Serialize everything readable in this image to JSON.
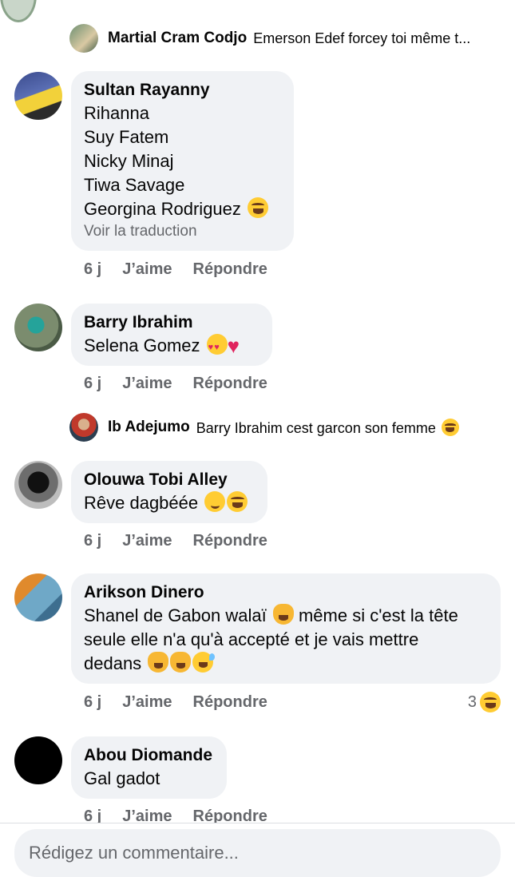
{
  "reply_1": {
    "author": "Martial Cram Codjo",
    "text": "Emerson Edef forcey toi même t..."
  },
  "comments": [
    {
      "author": "Sultan Rayanny",
      "lines": [
        "Rihanna",
        "Suy Fatem",
        "Nicky Minaj",
        "Tiwa Savage",
        "Georgina Rodriguez"
      ],
      "translate": "Voir la traduction",
      "time": "6 j",
      "like": "J’aime",
      "reply": "Répondre"
    },
    {
      "author": "Barry Ibrahim",
      "lines": [
        "Selena Gomez"
      ],
      "time": "6 j",
      "like": "J’aime",
      "reply": "Répondre"
    },
    {
      "author": "Olouwa Tobi Alley",
      "lines": [
        "Rêve dagbéée"
      ],
      "time": "6 j",
      "like": "J’aime",
      "reply": "Répondre"
    },
    {
      "author": "Arikson Dinero",
      "lines": [
        "Shanel de Gabon walaï",
        "même si c'est la tête",
        "seule elle n'a qu'à accepté et je vais mettre",
        "dedans"
      ],
      "time": "6 j",
      "like": "J’aime",
      "reply": "Répondre",
      "reaction_count": "3"
    },
    {
      "author": "Abou Diomande",
      "lines": [
        "Gal gadot"
      ],
      "time": "6 j",
      "like": "J’aime",
      "reply": "Répondre"
    }
  ],
  "reply_2": {
    "author": "Ib Adejumo",
    "text": "Barry Ibrahim cest garcon son femme"
  },
  "composer": {
    "placeholder": "Rédigez un commentaire..."
  },
  "icons": {
    "laugh": "face-with-tears-of-joy-icon",
    "love": "heart-eyes-icon",
    "heart": "red-heart-icon",
    "smile": "smiling-face-icon",
    "cat": "cat-tears-of-joy-icon",
    "sweat": "grinning-sweat-icon"
  },
  "colors": {
    "bubble": "#f0f2f5",
    "meta": "#65676b",
    "text": "#050505"
  }
}
